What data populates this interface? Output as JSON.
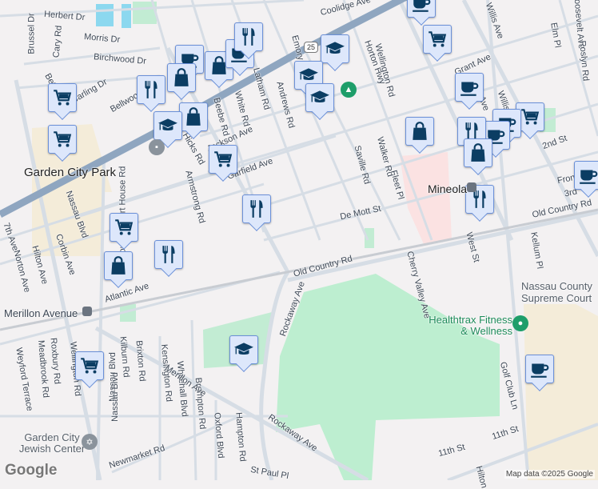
{
  "map": {
    "places": {
      "garden_city_park": "Garden City Park",
      "mineola": "Mineola",
      "merillon_avenue": "Merillon Avenue",
      "jewish_center": "Garden City Jewish Center",
      "court": "Nassau County Supreme Court",
      "healthtrax": "Healthtrax Fitness & Wellness"
    },
    "route_shield": "25",
    "streets": [
      "Herbert Dr",
      "Brussel Dr",
      "Cary Rd",
      "Morris Dr",
      "Birchwood Dr",
      "Betty Rd",
      "Carling Dr",
      "Bellwood Dr",
      "Coolidge Ave",
      "Horton Hwy",
      "Wellington Rd",
      "Emory Rd",
      "Andrews Rd",
      "Latham Rd",
      "White Rd",
      "Beebe Rd",
      "Jackson Ave",
      "Garfield Ave",
      "Armstrong Rd",
      "Hicks Rd",
      "County Court House Rd",
      "Nassau Blvd",
      "Nassau Blvd",
      "Saville Rd",
      "Walker Rd",
      "Fleet Pl",
      "De Mott St",
      "Grant Ave",
      "Willis Ave",
      "Elm Pl",
      "Roosevelt Ave",
      "Roslyn Rd",
      "2nd St",
      "Old Country Rd",
      "Old Country Rd",
      "Cherry Valley Ave",
      "West St",
      "Kellum Pl",
      "Rockaway Ave",
      "Atlantic Ave",
      "7th Ave",
      "Norton Ave",
      "Hilton Ave",
      "Corbin Ave",
      "Weyford Terrace",
      "Meadbrook Rd",
      "Roxbury Rd",
      "Wellington Rd",
      "Kilburn Rd",
      "Brixton Rd",
      "Kensington Rd",
      "Whitehall Blvd",
      "Brompton Rd",
      "Merillon Ave",
      "Oxford Blvd",
      "Hampton Rd",
      "Rockaway Ave",
      "Newmarket Rd",
      "Golf Club Ln",
      "11th St",
      "11th St",
      "Nassau Blvd",
      "Willis Ave",
      "3rd",
      "Fron",
      "Hilton",
      "St Paul Pl",
      "Willis Ave"
    ],
    "markers": [
      {
        "type": "cart"
      },
      {
        "type": "cart"
      },
      {
        "type": "cart"
      },
      {
        "type": "bag"
      },
      {
        "type": "fork"
      },
      {
        "type": "fork"
      },
      {
        "type": "bag"
      },
      {
        "type": "bag"
      },
      {
        "type": "grad"
      },
      {
        "type": "cart"
      },
      {
        "type": "fork"
      },
      {
        "type": "cup"
      },
      {
        "type": "bag"
      },
      {
        "type": "cup"
      },
      {
        "type": "fork"
      },
      {
        "type": "grad"
      },
      {
        "type": "grad"
      },
      {
        "type": "grad"
      },
      {
        "type": "cup"
      },
      {
        "type": "cart"
      },
      {
        "type": "cup"
      },
      {
        "type": "bag"
      },
      {
        "type": "cart"
      },
      {
        "type": "cup"
      },
      {
        "type": "cup"
      },
      {
        "type": "fork"
      },
      {
        "type": "bag"
      },
      {
        "type": "fork"
      },
      {
        "type": "cup"
      },
      {
        "type": "cup"
      },
      {
        "type": "cart"
      },
      {
        "type": "grad"
      }
    ],
    "attribution": "Map data ©2025 Google",
    "logo": "Google",
    "colors": {
      "marker_fill": "#dde7fb",
      "marker_border": "#6b90d8",
      "icon": "#0b3d63",
      "highway": "#8fa6c0",
      "park": "#bdeed0",
      "road": "#d6dde5"
    }
  }
}
